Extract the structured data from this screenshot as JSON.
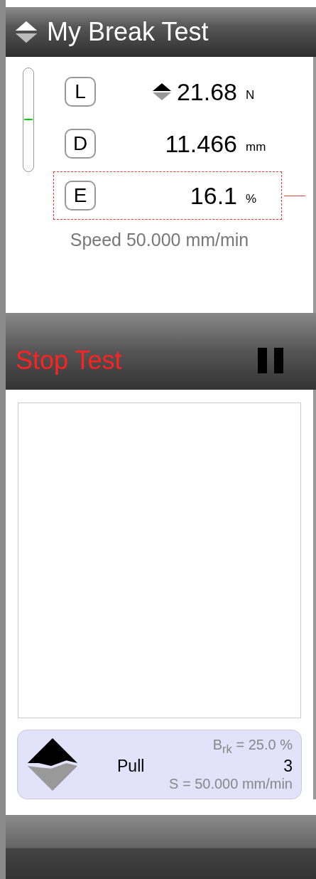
{
  "header": {
    "title": "My Break Test"
  },
  "gauge": {
    "level": 0.5
  },
  "readings": [
    {
      "letter": "L",
      "value": "21.68",
      "unit": "N",
      "trend_icon": true,
      "selected": false
    },
    {
      "letter": "D",
      "value": "11.466",
      "unit": "mm",
      "trend_icon": false,
      "selected": false
    },
    {
      "letter": "E",
      "value": "16.1",
      "unit": "%",
      "trend_icon": false,
      "selected": true
    }
  ],
  "speed": "Speed 50.000 mm/min",
  "action_bar": {
    "label": "Stop Test",
    "paused": false
  },
  "method_card": {
    "break_line": "B$_{rk}$  = 25.0 %",
    "name": "Pull",
    "count": "3",
    "speed_line": "S  = 50.000 mm/min"
  }
}
